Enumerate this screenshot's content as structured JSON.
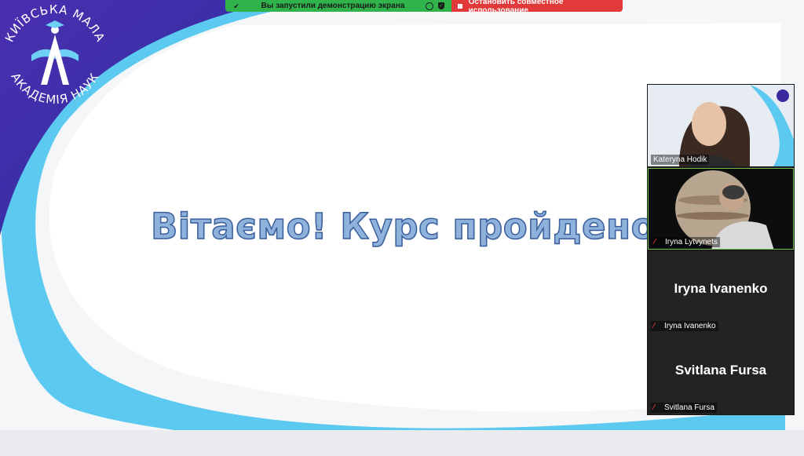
{
  "share_bar": {
    "status_text": "Вы запустили демонстрацию экрана",
    "stop_label": "Остановить совместное использование",
    "colors": {
      "status_bg": "#2fb34a",
      "stop_bg": "#e23a3a"
    }
  },
  "slide": {
    "logo_text_top": "КИЇВСЬКА МАЛА",
    "logo_text_bottom": "АКАДЕМІЯ НАУК",
    "headline": "Вітаємо! Курс пройдено!",
    "colors": {
      "brand_purple": "#3a2a9e",
      "wave_cyan": "#5cc9f0",
      "headline_fill": "#8fb2dc"
    }
  },
  "participants": [
    {
      "name": "Kateryna Hodik",
      "video": true,
      "muted": false
    },
    {
      "name": "Iryna Lytvynets",
      "video": true,
      "muted": true,
      "active_speaker": true
    },
    {
      "name": "Iryna Ivanenko",
      "display_name": "Iryna Ivanenko",
      "video": false,
      "muted": true
    },
    {
      "name": "Svitlana Fursa",
      "display_name": "Svitlana Fursa",
      "video": false,
      "muted": true
    }
  ]
}
